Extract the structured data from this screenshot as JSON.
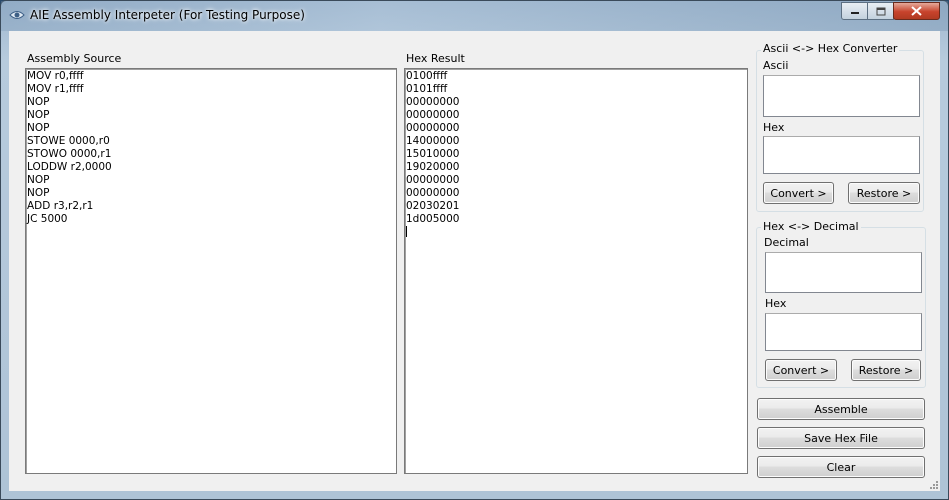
{
  "window": {
    "title": "AIE Assembly Interpeter (For Testing Purpose)"
  },
  "source": {
    "label": "Assembly Source",
    "lines": [
      "MOV r0,ffff",
      "MOV r1,ffff",
      "NOP",
      "NOP",
      "NOP",
      "STOWE 0000,r0",
      "STOWO 0000,r1",
      "LODDW r2,0000",
      "NOP",
      "NOP",
      "ADD r3,r2,r1",
      "JC 5000"
    ]
  },
  "hex_result": {
    "label": "Hex Result",
    "lines": [
      "0100ffff",
      "0101ffff",
      "00000000",
      "00000000",
      "00000000",
      "14000000",
      "15010000",
      "19020000",
      "00000000",
      "00000000",
      "02030201",
      "1d005000"
    ]
  },
  "ascii_converter": {
    "group_title": "Ascii <-> Hex Converter",
    "ascii_label": "Ascii",
    "hex_label": "Hex",
    "convert_label": "Convert >",
    "restore_label": "Restore >"
  },
  "decimal_converter": {
    "group_title": "Hex <-> Decimal",
    "decimal_label": "Decimal",
    "hex_label": "Hex",
    "convert_label": "Convert >",
    "restore_label": "Restore >"
  },
  "actions": {
    "assemble_label": "Assemble",
    "save_hex_label": "Save Hex File",
    "clear_label": "Clear"
  }
}
